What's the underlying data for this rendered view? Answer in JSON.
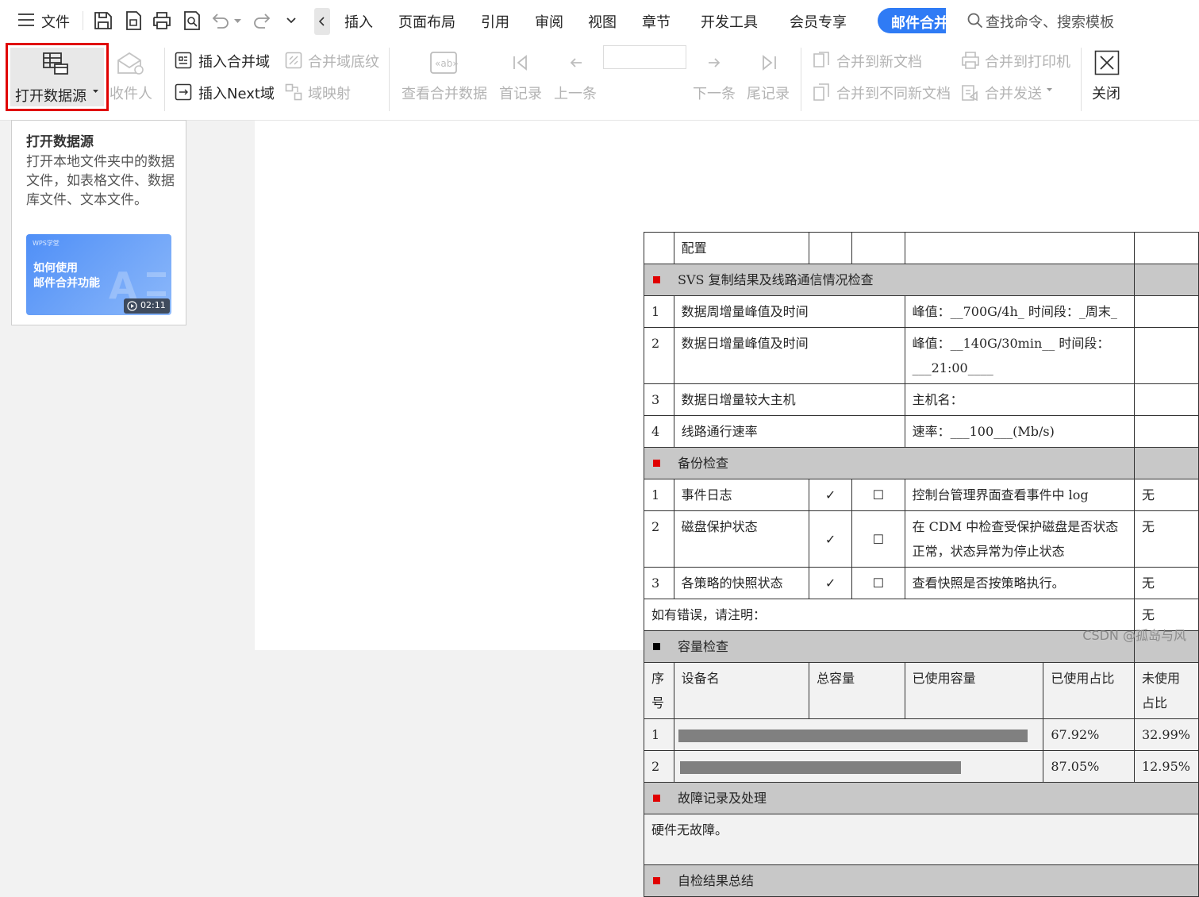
{
  "topbar": {
    "file_label": "文件",
    "menus": [
      "插入",
      "页面布局",
      "引用",
      "审阅",
      "视图",
      "章节",
      "开发工具",
      "会员专享"
    ],
    "active_tab": "邮件合并",
    "search_placeholder": "查找命令、搜索模板"
  },
  "ribbon": {
    "open_data_source": "打开数据源",
    "recipients": "收件人",
    "insert_merge_field": "插入合并域",
    "merge_field_shading": "合并域底纹",
    "insert_next_field": "插入Next域",
    "field_mapping": "域映射",
    "view_merged_data": "查看合并数据",
    "first_record": "首记录",
    "prev_record": "上一条",
    "record_input": "",
    "next_record": "下一条",
    "last_record": "尾记录",
    "merge_to_new_doc": "合并到新文档",
    "merge_to_printer": "合并到打印机",
    "merge_to_different_docs": "合并到不同新文档",
    "merge_send": "合并发送",
    "close": "关闭"
  },
  "tooltip": {
    "title": "打开数据源",
    "description": "打开本地文件夹中的数据文件，如表格文件、数据库文件、文本文件。",
    "video_brand": "WPS学堂",
    "video_title_line1": "如何使用",
    "video_title_line2": "邮件合并功能",
    "video_duration": "02:11"
  },
  "document": {
    "row_config": "配置",
    "section_svs": "SVS 复制结果及线路通信情况检查",
    "svs_rows": [
      {
        "no": "1",
        "item": "数据周增量峰值及时间",
        "value": "峰值：__700G/4h_ 时间段：_周末_"
      },
      {
        "no": "2",
        "item": "数据日增量峰值及时间",
        "value": "峰值：__140G/30min__ 时间段：___21:00____"
      },
      {
        "no": "3",
        "item": "数据日增量较大主机",
        "value": "主机名："
      },
      {
        "no": "4",
        "item": "线路通行速率",
        "value": "速率：___100___(Mb/s)"
      }
    ],
    "section_backup": "备份检查",
    "backup_rows": [
      {
        "no": "1",
        "item": "事件日志",
        "check": "✓",
        "box": "☐",
        "desc": "控制台管理界面查看事件中 log",
        "result": "无"
      },
      {
        "no": "2",
        "item": "磁盘保护状态",
        "check": "✓",
        "box": "☐",
        "desc": "在 CDM 中检查受保护磁盘是否状态正常，状态异常为停止状态",
        "result": "无"
      },
      {
        "no": "3",
        "item": "各策略的快照状态",
        "check": "✓",
        "box": "☐",
        "desc": "查看快照是否按策略执行。",
        "result": "无"
      }
    ],
    "error_note": "如有错误，请注明：",
    "error_result": "无",
    "section_capacity": "容量检查",
    "capacity_headers": [
      "序号",
      "设备名",
      "总容量",
      "已使用容量",
      "已使用占比",
      "未使用占比"
    ],
    "capacity_rows": [
      {
        "no": "1",
        "used_pct": "67.92%",
        "free_pct": "32.99%"
      },
      {
        "no": "2",
        "used_pct": "87.05%",
        "free_pct": "12.95%"
      }
    ],
    "section_fault": "故障记录及处理",
    "fault_text": "硬件无故障。",
    "section_summary": "自检结果总结"
  },
  "watermark": "CSDN @孤岛与风",
  "colors": {
    "accent_blue": "#2f7bf5",
    "highlight_red": "#e00000",
    "section_gray": "#c8c8c8"
  }
}
